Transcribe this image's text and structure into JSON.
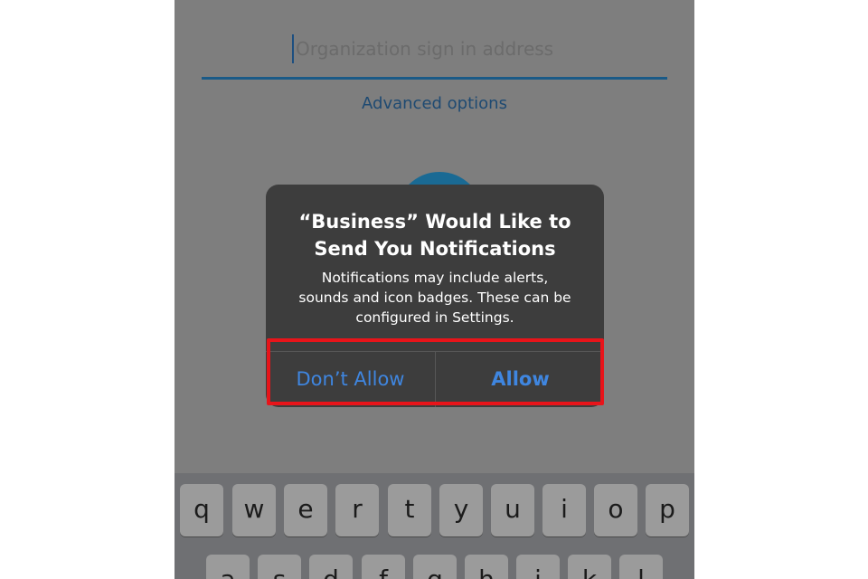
{
  "app": {
    "input": {
      "placeholder": "Organization sign in address",
      "value": ""
    },
    "advanced_options_label": "Advanced options"
  },
  "alert": {
    "title_line1": "“Business” Would Like to",
    "title_line2": "Send You Notifications",
    "message_line1": "Notifications may include alerts,",
    "message_line2": "sounds and icon badges. These can be",
    "message_line3": "configured in Settings.",
    "dont_allow_label": "Don’t Allow",
    "allow_label": "Allow"
  },
  "keyboard": {
    "row1": [
      "q",
      "w",
      "e",
      "r",
      "t",
      "y",
      "u",
      "i",
      "o",
      "p"
    ],
    "row2": [
      "a",
      "s",
      "d",
      "f",
      "g",
      "h",
      "j",
      "k",
      "l"
    ]
  },
  "colors": {
    "overlay_gray": "#7e7e7e",
    "alert_bg": "#3d3d3d",
    "button_blue": "#3f86e0",
    "highlight_red": "#e8141a",
    "underline_blue": "#1a5a87"
  }
}
